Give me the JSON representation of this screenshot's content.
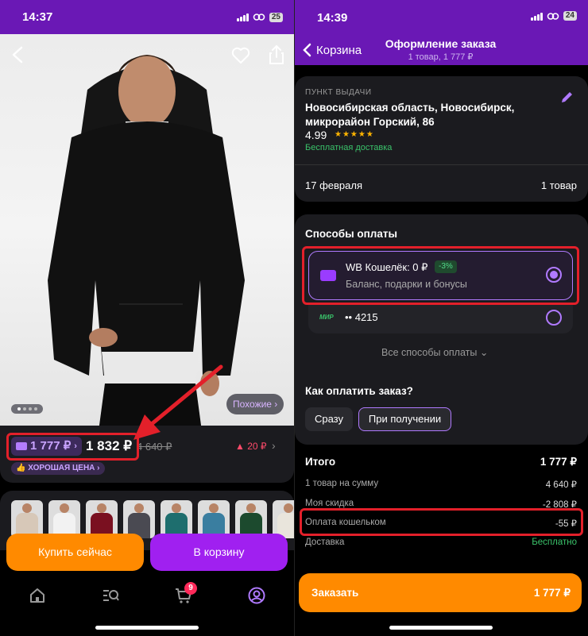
{
  "left": {
    "status": {
      "time": "14:37",
      "battery": "25"
    },
    "similar_label": "Похожие ›",
    "price": {
      "wallet_price": "1 777 ₽",
      "wallet_chevron": "›",
      "price": "1 832 ₽",
      "old_price": "4 640 ₽",
      "drop": "▲ 20 ₽",
      "chevron": "›",
      "badge": "👍 ХОРОШАЯ ЦЕНА ›"
    },
    "buttons": {
      "buy_now": "Купить сейчас",
      "add_to_cart": "В корзину"
    },
    "tabbar": {
      "cart_badge": "9"
    },
    "colors": {
      "accent": "#a020f0",
      "orange": "#ff8a00",
      "header": "#6a18b5"
    },
    "thumbnails": [
      "#d7c8b8",
      "#f2f2f2",
      "#7a1020",
      "#4a4a52",
      "#1e6e6e",
      "#3a7ea0",
      "#1c4a2e",
      "#e9e5dc"
    ]
  },
  "right": {
    "status": {
      "time": "14:39",
      "battery": "24"
    },
    "nav": {
      "back_label": "Корзина",
      "title": "Оформление заказа",
      "subtitle": "1 товар, 1 777 ₽"
    },
    "pickup": {
      "label": "ПУНКТ ВЫДАЧИ",
      "address": "Новосибирская область, Новосибирск, микрорайон Горский, 86",
      "rating": "4.99",
      "stars": "★★★★★",
      "delivery": "Бесплатная доставка"
    },
    "date_row": {
      "date": "17 февраля",
      "count": "1 товар"
    },
    "payment": {
      "title": "Способы оплаты",
      "wallet_title": "WB Кошелёк: 0 ₽",
      "wallet_discount": "-3%",
      "wallet_subtitle": "Баланс, подарки и бонусы",
      "card_system": "МИР",
      "card_number": "•• 4215",
      "all_methods": "Все способы оплаты  ⌄"
    },
    "how_to_pay": {
      "title": "Как оплатить заказ?",
      "now": "Сразу",
      "on_receipt": "При получении"
    },
    "summary": {
      "title": "Итого",
      "total": "1 777 ₽",
      "rows": [
        {
          "label": "1 товар на сумму",
          "value": "4 640 ₽"
        },
        {
          "label": "Моя скидка",
          "value": "-2 808 ₽"
        },
        {
          "label": "Оплата кошельком",
          "value": "-55 ₽"
        },
        {
          "label": "Доставка",
          "value": "Бесплатно"
        }
      ]
    },
    "order_button": {
      "label": "Заказать",
      "price": "1 777 ₽"
    }
  }
}
